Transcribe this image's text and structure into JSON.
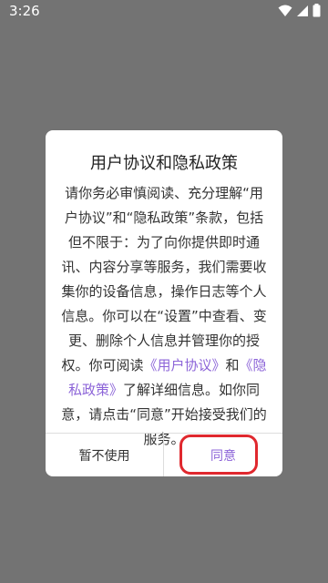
{
  "status_bar": {
    "time": "3:26"
  },
  "dialog": {
    "title": "用户协议和隐私政策",
    "body": {
      "part1": "请你务必审慎阅读、充分理解“用户协议”和“隐私政策”条款，包括但不限于：为了向你提供即时通讯、内容分享等服务，我们需要收集你的设备信息，操作日志等个人信息。你可以在“设置”中查看、变更、删除个人信息并管理你的授权。你可阅读",
      "link_user_agreement": "《用户协议》",
      "and": "和",
      "link_privacy_policy": "《隐私政策》",
      "part2": "了解详细信息。如你同意，请点击“同意”开始接受我们的服务。"
    },
    "buttons": {
      "decline": "暂不使用",
      "agree": "同意"
    }
  },
  "colors": {
    "accent": "#8c64d8",
    "overlay": "#737373",
    "highlight_ring": "#e0282e"
  }
}
